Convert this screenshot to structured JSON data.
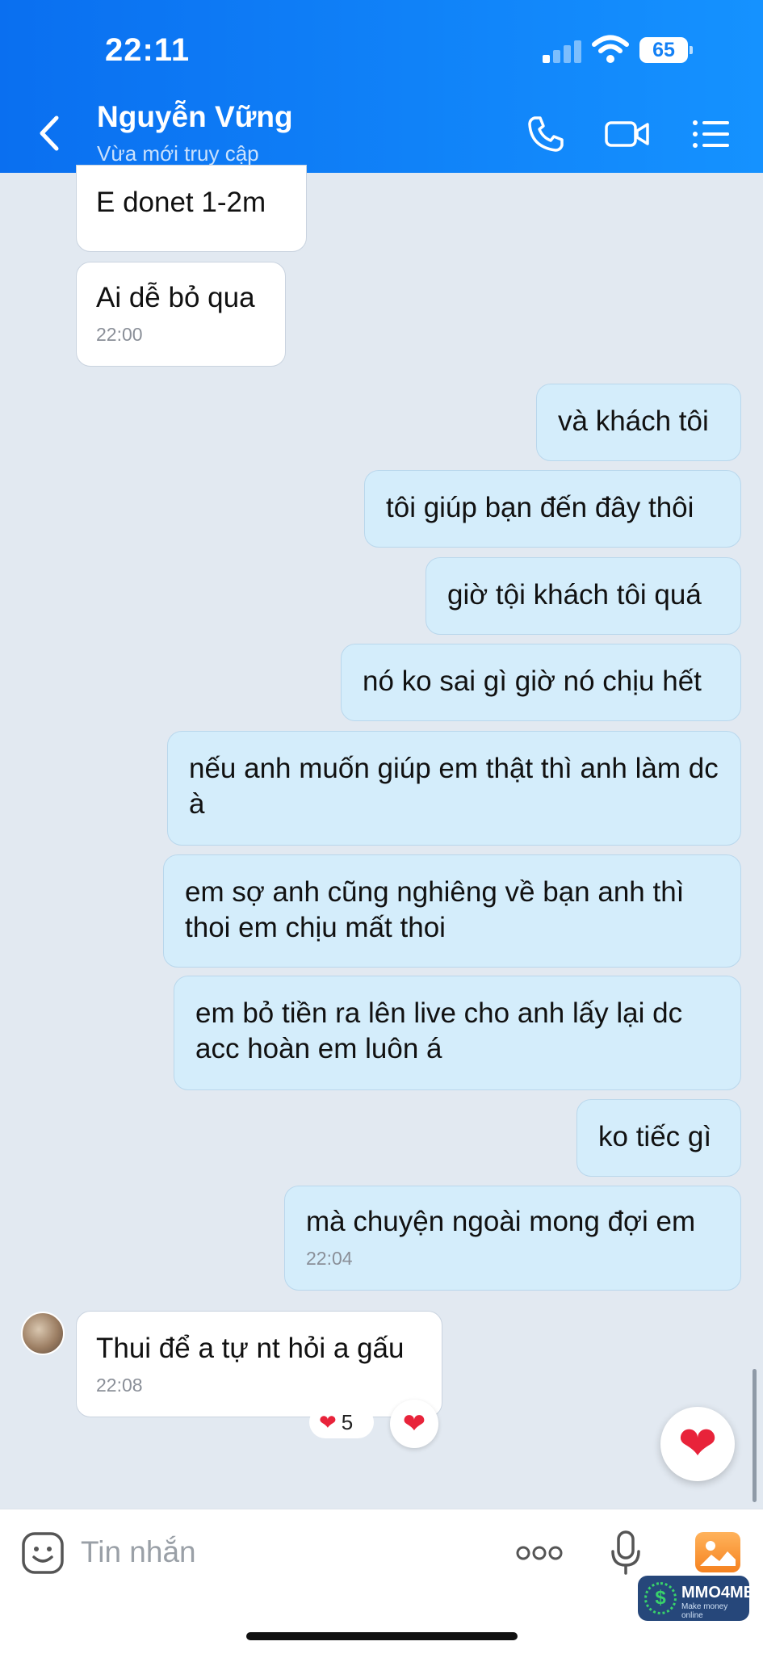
{
  "status_bar": {
    "time": "22:11",
    "battery": "65"
  },
  "header": {
    "contact_name": "Nguyễn Vững",
    "contact_status": "Vừa mới truy cập",
    "icons": [
      "back-chevron-icon",
      "phone-icon",
      "video-call-icon",
      "menu-list-icon"
    ]
  },
  "messages": [
    {
      "side": "in",
      "text": "E donet 1-2m"
    },
    {
      "side": "in",
      "text": "Ai dễ bỏ qua",
      "time": "22:00"
    },
    {
      "side": "out",
      "text": "và khách tôi"
    },
    {
      "side": "out",
      "text": "tôi giúp bạn đến đây thôi"
    },
    {
      "side": "out",
      "text": "giờ tội khách tôi quá"
    },
    {
      "side": "out",
      "text": "nó ko sai gì giờ nó chịu hết"
    },
    {
      "side": "out",
      "text": "nếu anh muốn giúp em thật thì anh làm dc à"
    },
    {
      "side": "out",
      "text": "em sợ anh cũng nghiêng về bạn anh thì thoi em chịu mất thoi"
    },
    {
      "side": "out",
      "text": "em bỏ tiền ra lên live cho anh lấy lại dc acc hoàn em luôn á"
    },
    {
      "side": "out",
      "text": "ko tiếc gì"
    },
    {
      "side": "out",
      "text": "mà chuyện ngoài mong đợi em",
      "time": "22:04"
    },
    {
      "side": "in",
      "text": "Thui để a tự nt hỏi a gấu",
      "time": "22:08"
    }
  ],
  "reaction": {
    "icon": "heart-icon",
    "count": "5"
  },
  "composer": {
    "placeholder": "Tin nhắn"
  },
  "watermark": {
    "title": "MMO4ME",
    "subtitle": "Make money online",
    "coin_glyph": "$"
  },
  "colors": {
    "header": "#1380f5",
    "outgoing_bubble": "#d4edfb",
    "incoming_bubble": "#ffffff",
    "chat_background": "#e2e9f1",
    "heart": "#e8233a"
  }
}
